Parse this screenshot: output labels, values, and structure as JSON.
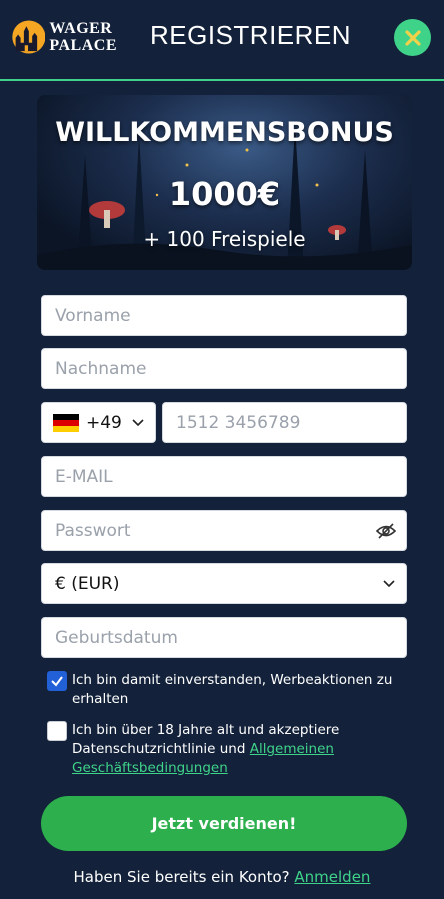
{
  "header": {
    "logo_line1": "WAGER",
    "logo_line2": "PALACE",
    "title": "REGISTRIEREN",
    "close_icon": "close-icon",
    "accent_color": "#3fd38a"
  },
  "banner": {
    "title": "WILLKOMMENSBONUS",
    "amount": "1000€",
    "spins": "+ 100 Freispiele"
  },
  "form": {
    "first_name_placeholder": "Vorname",
    "last_name_placeholder": "Nachname",
    "country_code": "+49",
    "phone_placeholder": "1512 3456789",
    "email_placeholder": "E-MAIL",
    "password_placeholder": "Passwort",
    "currency": "€ (EUR)",
    "birthdate_placeholder": "Geburtsdatum"
  },
  "consents": {
    "promo_text": "Ich bin damit einverstanden, Werbeaktionen zu erhalten",
    "promo_checked": true,
    "terms_text": "Ich bin über 18 Jahre alt und akzeptiere Datenschutzrichtlinie und ",
    "terms_link": "Allgemeinen Geschäftsbedingungen",
    "terms_checked": false
  },
  "cta": {
    "label": "Jetzt verdienen!",
    "color": "#2caf4c"
  },
  "footer": {
    "prompt": "Haben Sie bereits ein Konto? ",
    "login_link": "Anmelden"
  }
}
